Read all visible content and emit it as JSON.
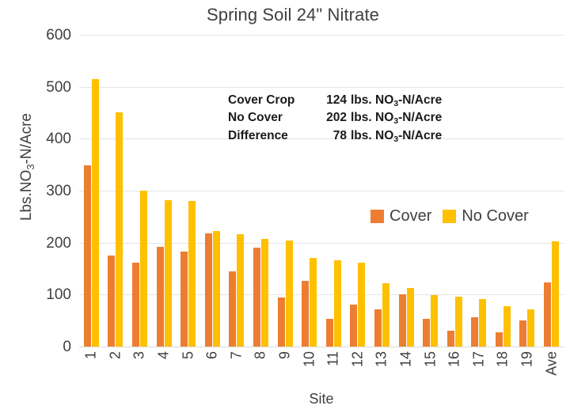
{
  "chart_data": {
    "type": "bar",
    "title": "Spring Soil 24\" Nitrate",
    "xlabel": "Site",
    "ylabel": "Lbs.NO3-N/Acre",
    "ylim": [
      0,
      600
    ],
    "ytick_step": 100,
    "yticks": [
      600,
      500,
      400,
      300,
      200,
      100,
      0
    ],
    "grid": true,
    "legend_position": "inside-right",
    "categories": [
      "1",
      "2",
      "3",
      "4",
      "5",
      "6",
      "7",
      "8",
      "9",
      "10",
      "11",
      "12",
      "13",
      "14",
      "15",
      "16",
      "17",
      "18",
      "19",
      "Ave"
    ],
    "series": [
      {
        "name": "Cover",
        "color": "#ED7D31",
        "values": [
          348,
          175,
          161,
          192,
          183,
          218,
          145,
          190,
          95,
          127,
          54,
          80,
          72,
          100,
          53,
          31,
          56,
          28,
          50,
          124
        ]
      },
      {
        "name": "No Cover",
        "color": "#FFC000",
        "values": [
          514,
          451,
          300,
          282,
          280,
          222,
          217,
          207,
          204,
          171,
          166,
          162,
          122,
          112,
          99,
          96,
          91,
          78,
          71,
          202
        ]
      }
    ],
    "annotations": [
      {
        "label": "Cover Crop",
        "value": "124",
        "unit_pre": "lbs. NO",
        "unit_sub": "3",
        "unit_post": "-N/Acre"
      },
      {
        "label": "No Cover",
        "value": "202",
        "unit_pre": "lbs. NO",
        "unit_sub": "3",
        "unit_post": "-N/Acre"
      },
      {
        "label": "Difference",
        "value": "78",
        "unit_pre": "lbs. NO",
        "unit_sub": "3",
        "unit_post": "-N/Acre"
      }
    ]
  },
  "ylabel_parts": {
    "pre": "Lbs.NO",
    "sub": "3",
    "post": "-N/Acre"
  }
}
